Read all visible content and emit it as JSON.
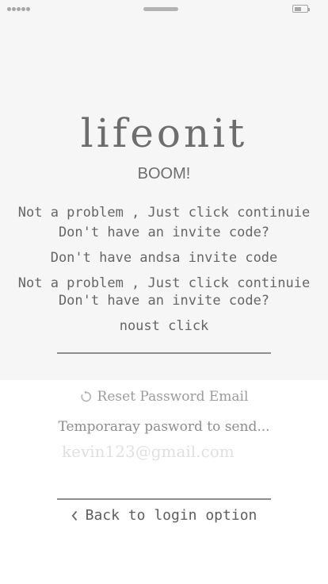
{
  "status_bar": {
    "signal_icon": "signal-dots-icon",
    "handle_icon": "drag-handle-icon",
    "battery_icon": "battery-icon"
  },
  "app": {
    "logo": "lifeonit",
    "tagline": "BOOM!"
  },
  "messages": [
    "Not a problem , Just click continuie",
    "Don't have an invite code?",
    "Don't have andsa invite code",
    "Not a problem , Just click continuie",
    "Don't have an invite code?",
    "noust click"
  ],
  "reset": {
    "label": "Reset Password Email",
    "icon": "refresh-icon",
    "instruction": "Temporaray pasword to send...",
    "email_placeholder": "kevin123@gmail.com"
  },
  "back": {
    "label": "Back to login option",
    "icon": "chevron-left-icon"
  },
  "colors": {
    "panel": "#f6f6f6",
    "background": "#ffffff",
    "text": "#6f6f6f",
    "muted": "#9c9c9c",
    "divider": "#8e8e8e"
  }
}
